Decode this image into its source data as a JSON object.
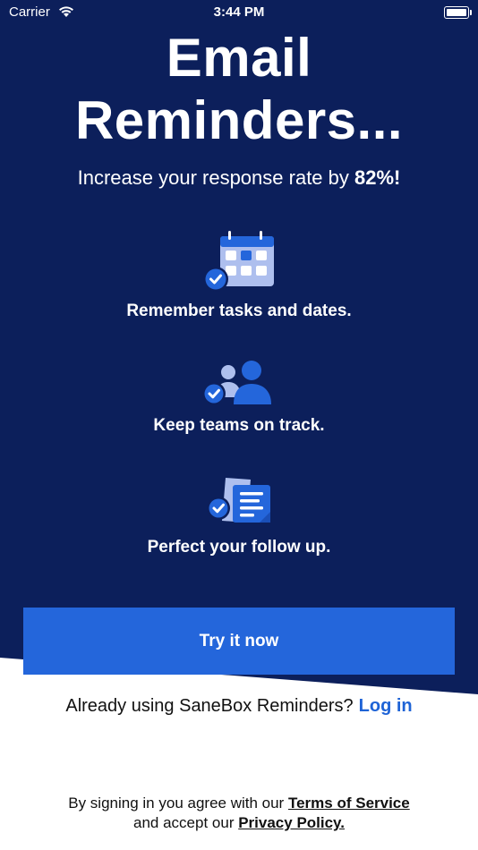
{
  "status_bar": {
    "carrier": "Carrier",
    "time": "3:44 PM",
    "wifi_icon": "wifi-icon",
    "battery_icon": "battery-icon"
  },
  "hero": {
    "title_line1": "Email",
    "title_line2": "Reminders...",
    "subtitle_prefix": "Increase your response rate by",
    "subtitle_highlight": "82%!"
  },
  "features": [
    {
      "icon": "calendar-check-icon",
      "label": "Remember tasks and dates."
    },
    {
      "icon": "team-check-icon",
      "label": "Keep teams on track."
    },
    {
      "icon": "document-check-icon",
      "label": "Perfect your follow up."
    }
  ],
  "cta": {
    "label": "Try it now"
  },
  "login": {
    "prompt": "Already using SaneBox Reminders?",
    "link_label": "Log in"
  },
  "legal": {
    "prefix": "By signing in you agree with our",
    "terms_label": "Terms of Service",
    "middle": "and accept our",
    "privacy_label": "Privacy Policy."
  },
  "colors": {
    "navy_background": "#0c1f5b",
    "accent_blue": "#2466db",
    "link_blue": "#1e63d6",
    "icon_light": "#aebfee",
    "white": "#ffffff"
  }
}
